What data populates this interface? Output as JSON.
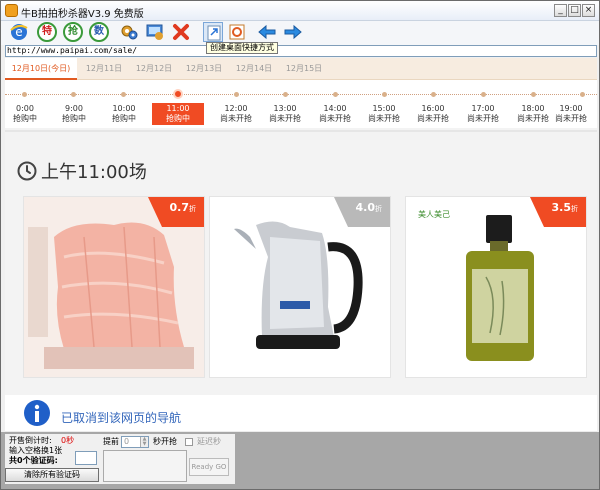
{
  "window": {
    "title": "牛B拍拍秒杀器V3.9  免费版",
    "minimize": "_",
    "maximize": "□",
    "close": "×"
  },
  "toolbar": {
    "buttons": [
      {
        "icon": "ie-icon"
      },
      {
        "icon": "special-icon",
        "label": "特"
      },
      {
        "icon": "grab-icon",
        "label": "抢"
      },
      {
        "icon": "count-icon",
        "label": "数"
      },
      {
        "icon": "settings-icon"
      },
      {
        "icon": "settings-monitor-icon"
      },
      {
        "icon": "delete-icon"
      },
      {
        "icon": "desktop-shortcut-icon"
      },
      {
        "icon": "refresh-page-icon"
      },
      {
        "icon": "back-arrow-icon"
      },
      {
        "icon": "forward-arrow-icon"
      }
    ],
    "tooltip": "创建桌面快捷方式"
  },
  "address": {
    "url": "http://www.paipai.com/sale/"
  },
  "dates": [
    "12月10日(今日)",
    "12月11日",
    "12月12日",
    "12月13日",
    "12月14日",
    "12月15日"
  ],
  "timeline": [
    {
      "time": "0:00",
      "status": "抢购中"
    },
    {
      "time": "9:00",
      "status": "抢购中"
    },
    {
      "time": "10:00",
      "status": "抢购中"
    },
    {
      "time": "11:00",
      "status": "抢购中"
    },
    {
      "time": "12:00",
      "status": "尚未开抢"
    },
    {
      "time": "13:00",
      "status": "尚未开抢"
    },
    {
      "time": "14:00",
      "status": "尚未开抢"
    },
    {
      "time": "15:00",
      "status": "尚未开抢"
    },
    {
      "time": "16:00",
      "status": "尚未开抢"
    },
    {
      "time": "17:00",
      "status": "尚未开抢"
    },
    {
      "time": "18:00",
      "status": "尚未开抢"
    },
    {
      "time": "19:00",
      "status": "尚未开抢"
    }
  ],
  "session": {
    "title": "上午11:00场"
  },
  "products": [
    {
      "discount": "0.7",
      "unit": "折",
      "badge_color": "#f04b23",
      "brand": ""
    },
    {
      "discount": "4.0",
      "unit": "折",
      "badge_color": "#b9b9b9",
      "brand": ""
    },
    {
      "discount": "3.5",
      "unit": "折",
      "badge_color": "#f04b23",
      "brand": "美人美己"
    }
  ],
  "nav": {
    "cancel_text": "已取消到该网页的导航"
  },
  "panel": {
    "countdown_label": "开售倒计时:",
    "countdown_value": "0秒",
    "space_label": "输入空格换1张",
    "captcha_count": "共0个验证码:",
    "clear_button": "清除所有验证码",
    "advance_label": "提前",
    "advance_value": "0",
    "seconds_label": "秒开抢",
    "delay_label": "延迟秒",
    "ready_button": "Ready GO"
  }
}
